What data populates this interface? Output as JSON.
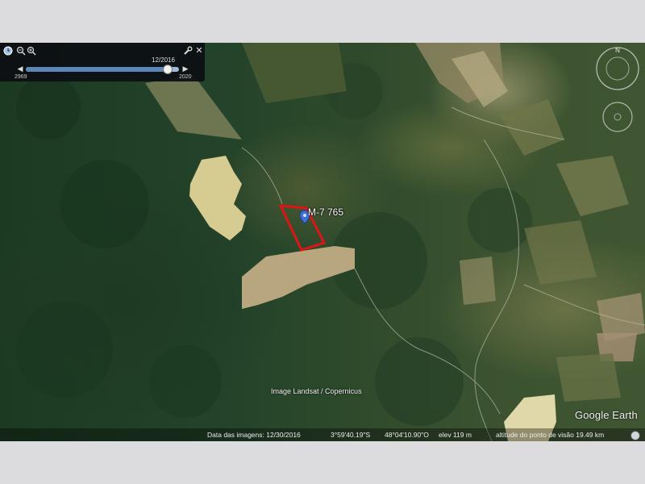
{
  "time_slider": {
    "current_date": "12/2016",
    "start_year": "2969",
    "end_year": "2020",
    "position_fraction": 0.92,
    "icons": [
      "clock-icon",
      "zoom-out-icon",
      "zoom-in-icon",
      "settings-wrench-icon",
      "close-icon"
    ]
  },
  "map": {
    "placemark_label": "M-7 765",
    "attribution": "Image Landsat / Copernicus",
    "brand": "Google Earth",
    "highlight_color": "#e01414",
    "placemark_color": "#3f6fd8"
  },
  "status_bar": {
    "imagery_date": "Data das imagens: 12/30/2016",
    "latitude": "3°59'40.19\"S",
    "longitude": "48°04'10.90\"O",
    "elevation": "elev   119 m",
    "eye_altitude": "altitude do ponto de visão   19.49 km"
  }
}
